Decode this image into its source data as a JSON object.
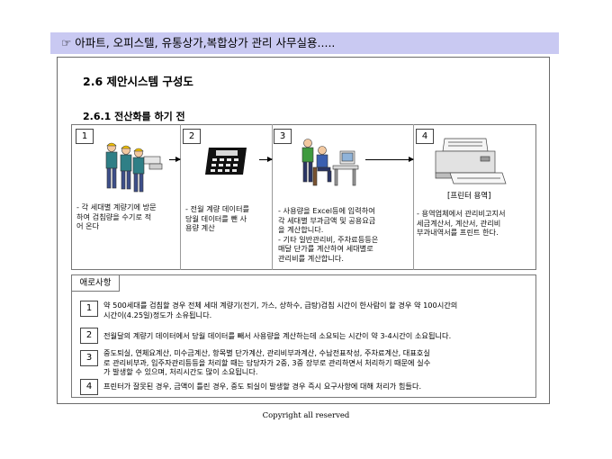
{
  "banner": {
    "icon": "pointing-hand-icon",
    "symbol": "☞",
    "text": "아파트, 오피스텔, 유통상가,복합상가 관리 사무실용....."
  },
  "section": {
    "title": "2.6 제안시스템 구성도",
    "subtitle": "2.6.1 전산화를 하기 전"
  },
  "steps": [
    {
      "number": "1",
      "icon": "meter-readers-illustration",
      "desc": "- 각 세대별 계량기에 방문\n하여 검침량을 수기로 적\n어 온다"
    },
    {
      "number": "2",
      "icon": "calculator-illustration",
      "desc": "- 전월 계량 데이터를\n당월 데이터를 뺀 사\n용량 계산"
    },
    {
      "number": "3",
      "icon": "office-workers-illustration",
      "desc": "- 사용량을 Excel등에 입력하여\n각 세대별 부과금액 및 공용요금\n을 계산합니다.\n- 기타 일반관리비, 주차료등등은\n매달 단가를 계산하여 세대별로\n관리비를 계산합니다."
    },
    {
      "number": "4",
      "icon": "printer-illustration",
      "label": "[프린터 용역]",
      "desc": "- 용역업체에서 관리비고지서\n세금계산서, 계산서, 관리비\n부과내역서를 프린트 한다."
    }
  ],
  "notes": {
    "heading": "애로사항",
    "items": [
      {
        "number": "1",
        "text": "약 500세대를 검침할 경우 전체 세대 계량기(전기, 가스, 상하수, 급탕)검침 시간이 한사람이 할 경우 약 100시간의\n시간이(4.25일)정도가 소유됩니다."
      },
      {
        "number": "2",
        "text": "전월달의 계량기 데이터에서 당월 데이터를 빼서 사용량을 계산하는데 소요되는 시간이 약 3-4시간이 소요됩니다."
      },
      {
        "number": "3",
        "text": "중도퇴실, 연체요계산, 미수금계산, 항목별 단가계산, 관리비부과계산, 수납전표작성, 주차료계산, 대표호실\n로 관리비부과, 입주자관리등등을 처리할 때는 담당자가 2중, 3중 장부로 관리하면서 처리하기 때문에 실수\n가 발생할 수 있으며, 처리시간도 많이 소요됩니다."
      },
      {
        "number": "4",
        "text": "프린터가 잘못된 경우, 금액이 틀린 경우, 중도 퇴실이 발생할 경우 즉시 요구사항에 대해 처리가 힘들다."
      }
    ]
  },
  "footer": {
    "copyright": "Copyright all reserved"
  }
}
